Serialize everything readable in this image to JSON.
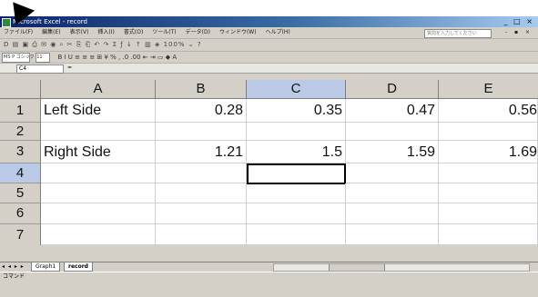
{
  "window": {
    "title": "Microsoft Excel - record",
    "controls": "_ □ ×"
  },
  "menubar": {
    "items": [
      "ファイル(F)",
      "編集(E)",
      "表示(V)",
      "挿入(I)",
      "書式(O)",
      "ツール(T)",
      "データ(D)",
      "ウィンドウ(W)",
      "ヘルプ(H)"
    ],
    "help_placeholder": "質問を入力してください",
    "right_controls": "- ▪ ×"
  },
  "toolbar": {
    "glyphs": "D ▤ ▣ ⎙ ✉ ◉ ⌕ ✂ ⎘ ⎗ ↶ ↷ Σ ƒ ↓ ↑ ▥ ◈ 100% ⌄ ?"
  },
  "formatbar": {
    "font": "MS P ゴシック",
    "size": "11",
    "glyphs": "B I U ≡ ≡ ≡ ⊞ ¥ % , .0 .00 ⇤ ⇥ ▭ ◆ A"
  },
  "formula_bar": {
    "name_box": "C4",
    "fx": "="
  },
  "sheet": {
    "columns": [
      "A",
      "B",
      "C",
      "D",
      "E"
    ],
    "rows": [
      "1",
      "2",
      "3",
      "4",
      "5",
      "6",
      "7"
    ],
    "cells": {
      "A1": "Left Side",
      "B1": "0.28",
      "C1": "0.35",
      "D1": "0.47",
      "E1": "0.56",
      "A3": "Right Side",
      "B3": "1.21",
      "C3": "1.5",
      "D3": "1.59",
      "E3": "1.69"
    },
    "active_cell": "C4"
  },
  "sheet_tabs": {
    "nav": "◂ ◂ ▸ ▸",
    "tabs": [
      "Graph1",
      "record"
    ],
    "active": "record"
  },
  "statusbar": {
    "text": "コマンド"
  }
}
